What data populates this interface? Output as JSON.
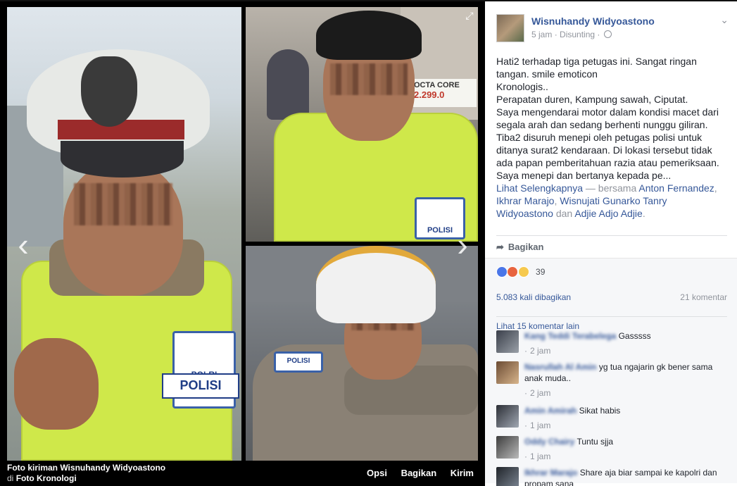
{
  "viewer": {
    "caption_poster": "Foto kiriman Wisnuhandy Widyoastono",
    "caption_in": "di",
    "caption_album": "Foto Kronologi",
    "actions": [
      "Opsi",
      "Bagikan",
      "Kirim"
    ],
    "photo1_badge": "POLRI",
    "photo1_badge2": "POLISI",
    "photo2_badge": "POLISI",
    "photo2_store": "OCTA CORE",
    "photo2_price": "2.299.0",
    "photo3_badge": "POLISI"
  },
  "post": {
    "author": "Wisnuhandy Widyoastono",
    "time": "5 jam",
    "separator": "·",
    "location_label": "Disunting",
    "lines": [
      "Hati2 terhadap tiga petugas ini. Sangat ringan tangan. smile emoticon",
      "Kronologis..",
      "Perapatan duren, Kampung sawah, Ciputat.",
      "Saya mengendarai motor dalam kondisi macet dari segala arah dan sedang berhenti nunggu giliran.",
      "Tiba2 disuruh menepi oleh petugas polisi untuk ditanya surat2 kendaraan. Di lokasi tersebut tidak ada papan pemberitahuan razia atau pemeriksaan. Saya menepi dan bertanya kepada pe..."
    ],
    "see_more": "Lihat Selengkapnya",
    "with_label": "— bersama",
    "tagged": [
      "Anton Fernandez",
      "Ikhrar Marajo",
      "Wisnujati Gunarko Tanry Widyoastono",
      "Adjie Adjo Adjie"
    ],
    "and_label": "dan",
    "share_label": "Bagikan"
  },
  "engagement": {
    "reaction_count": "39",
    "shares": "5.083 kali dibagikan",
    "comments": "21 komentar",
    "view_more": "Lihat 15 komentar lain"
  },
  "comments": [
    {
      "name": "Kang Teddi Terabelega",
      "text": "Gasssss",
      "time": "2 jam"
    },
    {
      "name": "Nasrullah Al Amin",
      "text": "yg tua ngajarin gk bener sama anak muda..",
      "time": "2 jam"
    },
    {
      "name": "Amin Amirah",
      "text": "Sikat habis",
      "time": "1 jam"
    },
    {
      "name": "Oddy Chairy",
      "text": "Tuntu sjja",
      "time": "1 jam"
    },
    {
      "name": "Ikhrar Marajo",
      "text": "Share aja biar sampai ke kapolri dan propam sana",
      "time": ""
    }
  ],
  "icons": {
    "expand": "expand-icon",
    "prev": "chevron-left-icon",
    "next": "chevron-right-icon",
    "globe": "globe-icon",
    "chevron": "chevron-down-icon",
    "share": "share-arrow-icon"
  },
  "colors": {
    "link": "#365899",
    "muted": "#90949c",
    "vest": "#cfe84a"
  }
}
